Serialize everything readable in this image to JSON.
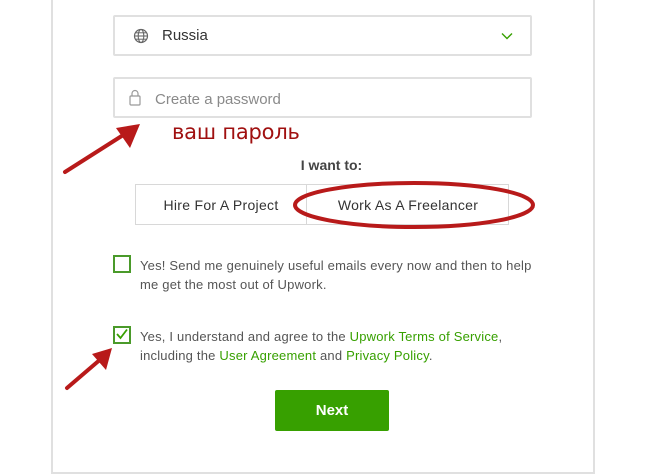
{
  "country": {
    "value": "Russia",
    "icon": "globe-icon"
  },
  "password": {
    "placeholder": "Create a password",
    "value": ""
  },
  "annotation": {
    "label": "ваш пароль",
    "color": "#a01010"
  },
  "want": {
    "label": "I want to:",
    "options": [
      "Hire For A Project",
      "Work As A Freelancer"
    ]
  },
  "emails_checkbox": {
    "text": "Yes! Send me genuinely useful emails every now and then to help me get the most out of Upwork.",
    "checked": false
  },
  "terms_checkbox": {
    "checked": true,
    "pre": "Yes, I understand and agree to the ",
    "link1": "Upwork Terms of Service",
    "mid1": ", including the ",
    "link2": "User Agreement",
    "mid2": " and ",
    "link3": "Privacy Policy",
    "end": "."
  },
  "next": {
    "label": "Next"
  },
  "colors": {
    "accent": "#37a000",
    "checkbox_border": "#4a9a2a",
    "annotation": "#a01010"
  }
}
